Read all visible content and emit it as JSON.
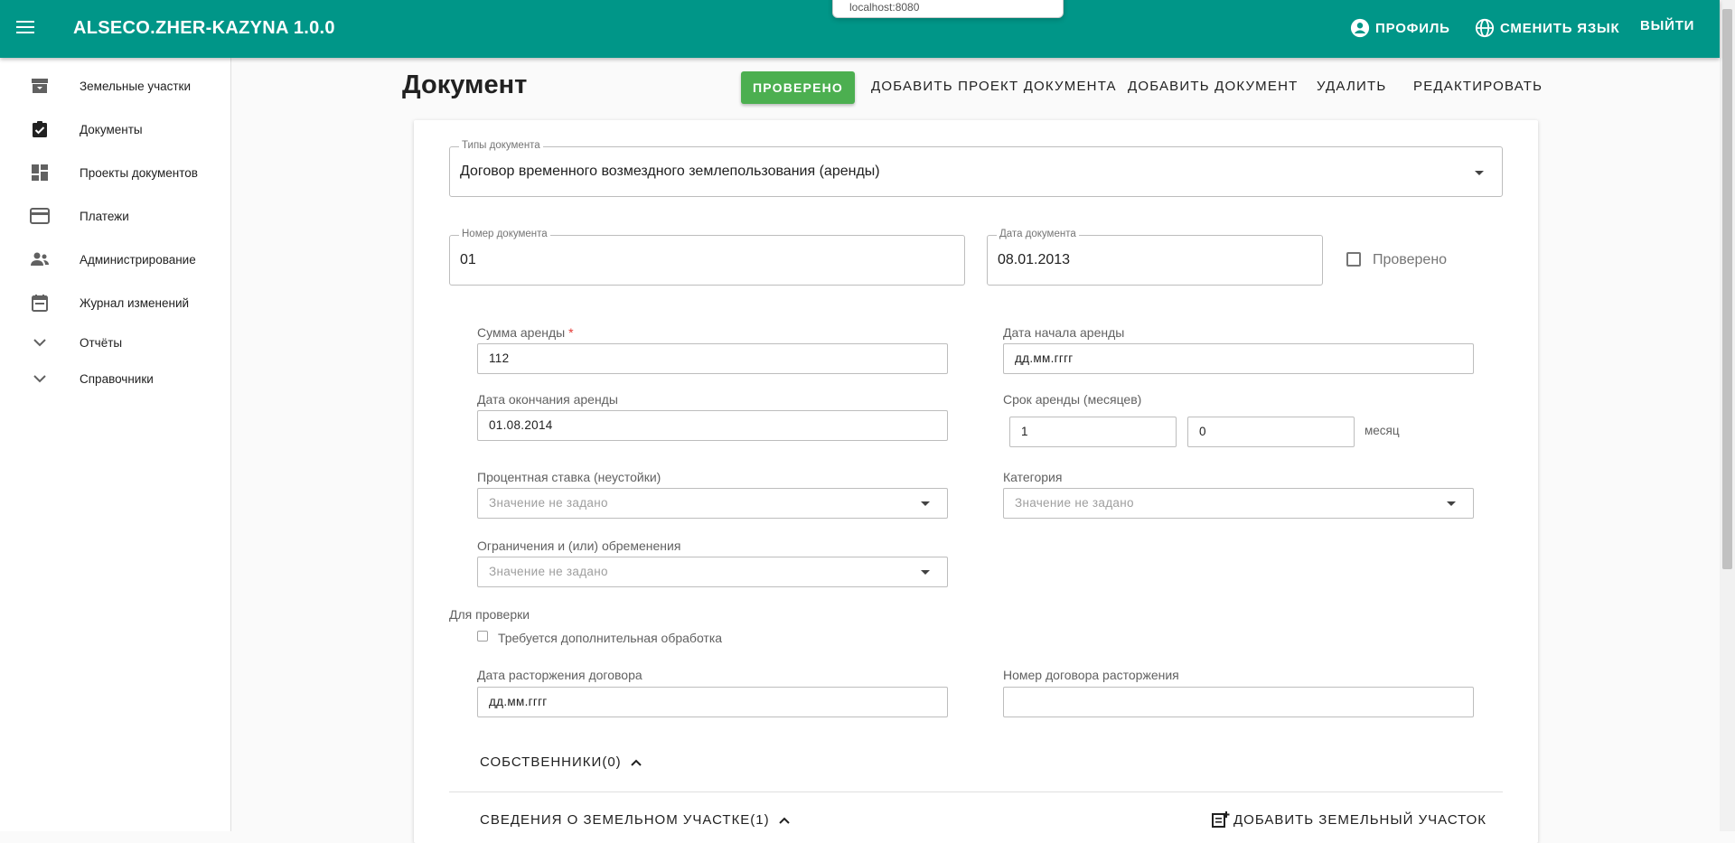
{
  "app": {
    "title": "ALSECO.ZHER-KAZYNA 1.0.0",
    "tooltip_url": "localhost:8080"
  },
  "header": {
    "profile": "ПРОФИЛЬ",
    "language": "СМЕНИТЬ ЯЗЫК",
    "logout": "ВЫЙТИ"
  },
  "sidebar": {
    "items": [
      {
        "label": "Земельные участки",
        "icon": "archive-icon"
      },
      {
        "label": "Документы",
        "icon": "clipboard-check-icon"
      },
      {
        "label": "Проекты документов",
        "icon": "dashboard-icon"
      },
      {
        "label": "Платежи",
        "icon": "credit-card-icon"
      },
      {
        "label": "Администрирование",
        "icon": "people-icon"
      },
      {
        "label": "Журнал изменений",
        "icon": "calendar-icon"
      },
      {
        "label": "Отчёты",
        "icon": "chevron-down-icon"
      },
      {
        "label": "Справочники",
        "icon": "chevron-down-icon"
      }
    ]
  },
  "page": {
    "title": "Документ",
    "actions": {
      "verified": "ПРОВЕРЕНО",
      "add_project": "ДОБАВИТЬ ПРОЕКТ ДОКУМЕНТА",
      "add_document": "ДОБАВИТЬ ДОКУМЕНТ",
      "delete": "УДАЛИТЬ",
      "edit": "РЕДАКТИРОВАТЬ"
    }
  },
  "form": {
    "doc_type": {
      "label": "Типы документа",
      "value": "Договор временного возмездного землепользования (аренды)"
    },
    "doc_number": {
      "label": "Номер документа",
      "value": "01"
    },
    "doc_date": {
      "label": "Дата документа",
      "value": "08.01.2013"
    },
    "verified_checkbox": "Проверено",
    "rent_sum": {
      "label": "Сумма аренды",
      "required_mark": "*",
      "value": "112"
    },
    "rent_start": {
      "label": "Дата начала аренды",
      "value": "дд.мм.гггг"
    },
    "rent_end": {
      "label": "Дата окончания аренды",
      "value": "01.08.2014"
    },
    "rent_term": {
      "label": "Срок аренды (месяцев)",
      "value1": "1",
      "value2": "0",
      "unit": "месяц"
    },
    "interest_rate": {
      "label": "Процентная ставка (неустойки)",
      "value": "Значение не задано"
    },
    "category": {
      "label": "Категория",
      "value": "Значение не задано"
    },
    "restrictions": {
      "label": "Ограничения и (или) обременения",
      "value": "Значение не задано"
    },
    "for_check": {
      "label": "Для проверки",
      "extra_processing": "Требуется дополнительная обработка"
    },
    "termination_date": {
      "label": "Дата расторжения договора",
      "value": "дд.мм.гггг"
    },
    "termination_number": {
      "label": "Номер договора расторжения",
      "value": ""
    }
  },
  "sections": {
    "owners": "СОБСТВЕННИКИ(0)",
    "land_info": "СВЕДЕНИЯ О ЗЕМЕЛЬНОМ УЧАСТКЕ(1)",
    "add_land": "ДОБАВИТЬ ЗЕМЕЛЬНЫЙ УЧАСТОК"
  },
  "colors": {
    "appbar": "#009688",
    "verified_button": "#4caf50",
    "required": "#e53935"
  }
}
